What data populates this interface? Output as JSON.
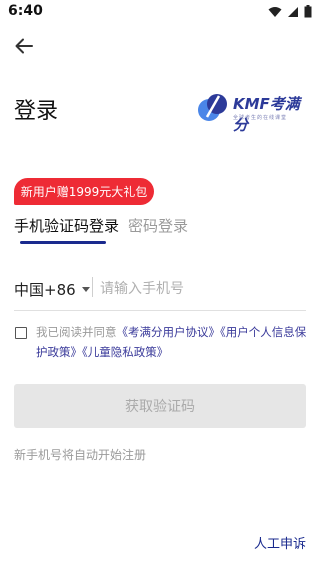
{
  "status_bar": {
    "time": "6:40"
  },
  "page": {
    "title": "登录"
  },
  "logo": {
    "text": "KMF考满分",
    "subtitle": "全球考生的在线课堂"
  },
  "promo": {
    "text": "新用户赠1999元大礼包"
  },
  "tabs": [
    {
      "label": "手机验证码登录",
      "active": true
    },
    {
      "label": "密码登录",
      "active": false
    }
  ],
  "phone": {
    "country_code": "中国+86",
    "placeholder": "请输入手机号",
    "value": ""
  },
  "agreement": {
    "prefix": "我已阅读并同意",
    "link1": "《考满分用户协议》",
    "link2": "《用户个人信息保护政策》",
    "link3": "《儿童隐私政策》"
  },
  "submit": {
    "label": "获取验证码"
  },
  "hint": "新手机号将自动开始注册",
  "support": {
    "label": "人工申诉"
  },
  "colors": {
    "accent": "#1a2a8e",
    "promo": "#ee2b35",
    "link": "#3a3a9a"
  }
}
